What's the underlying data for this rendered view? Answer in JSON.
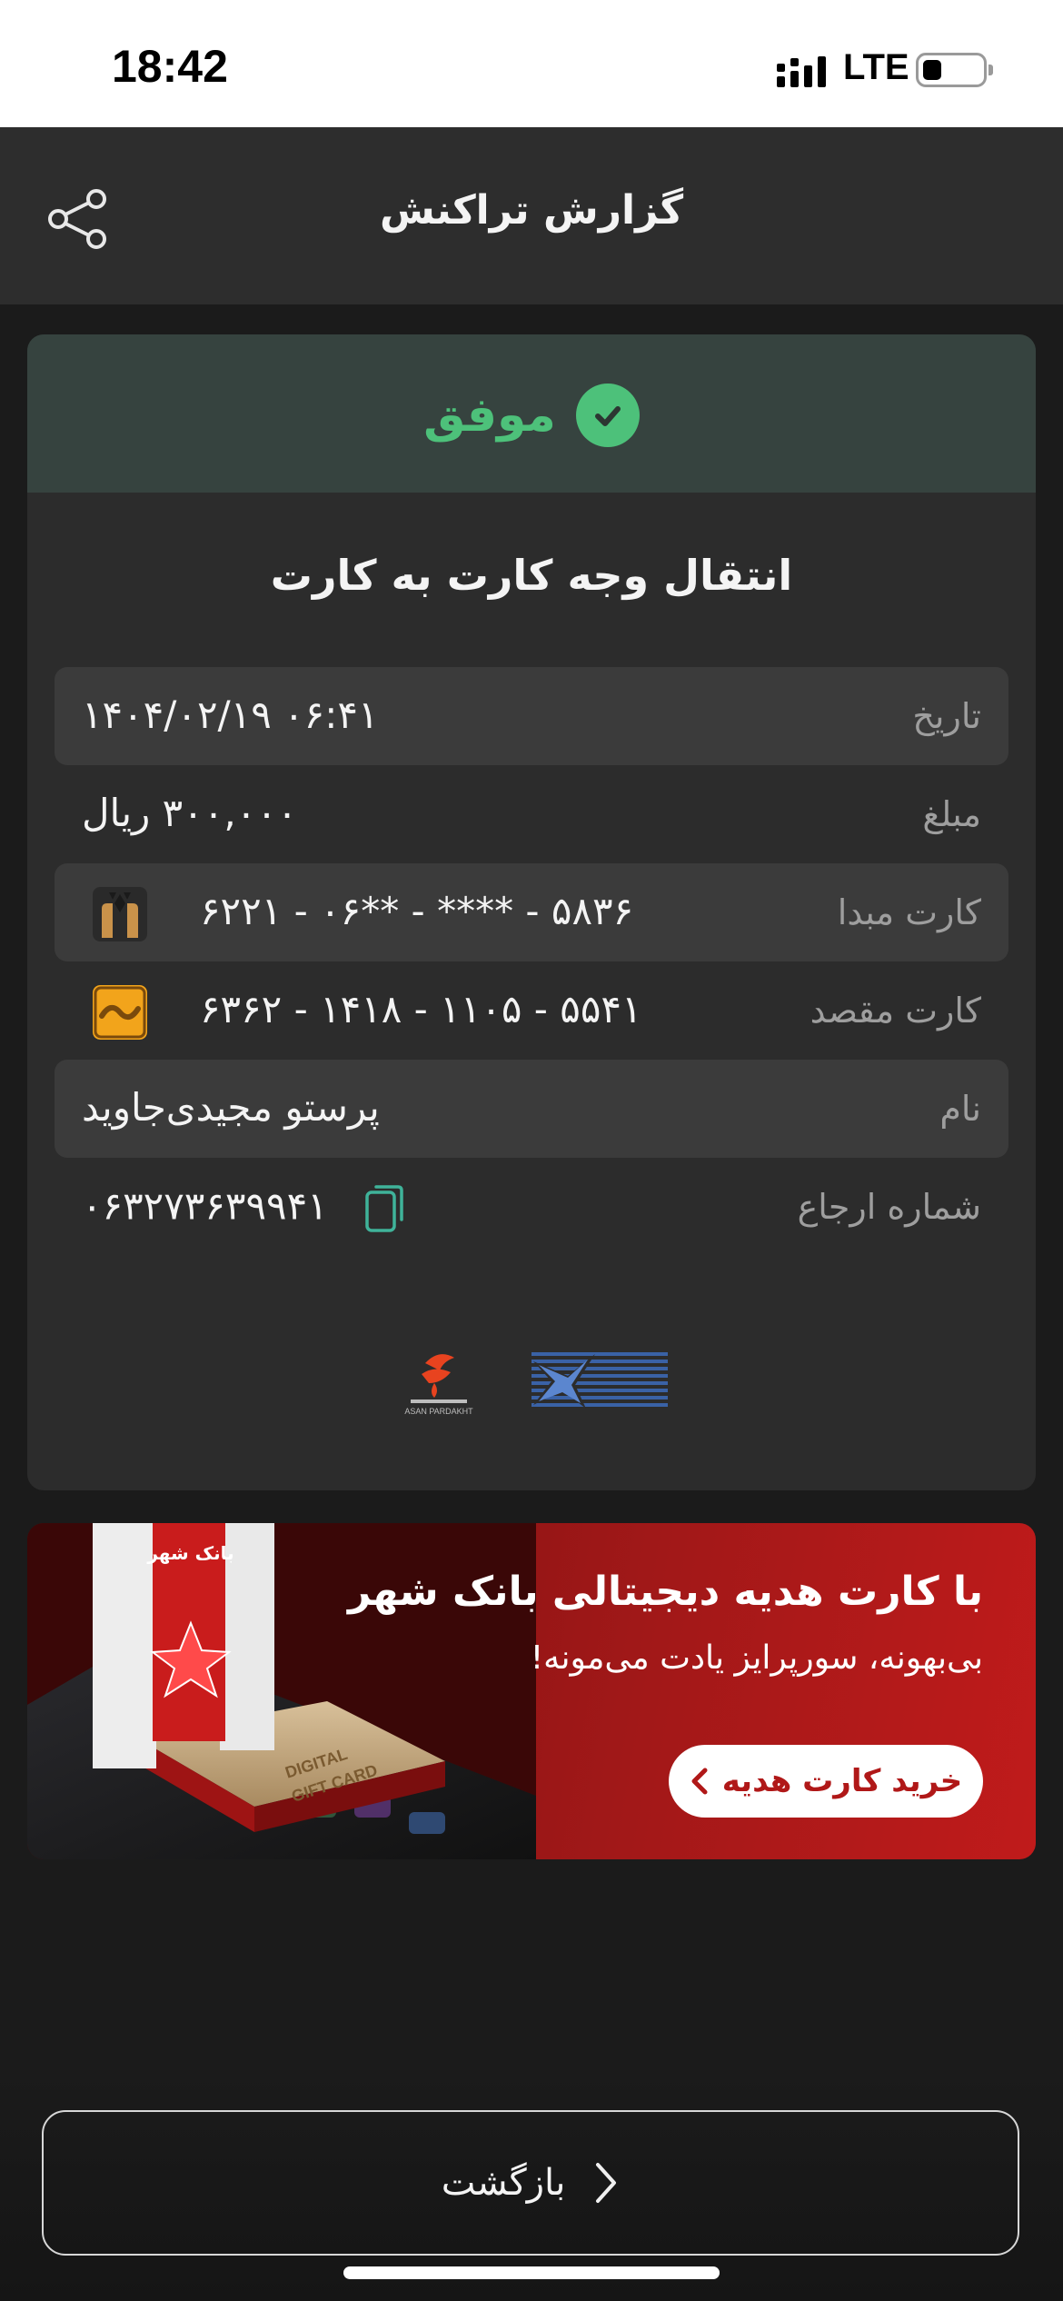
{
  "status_bar": {
    "time": "18:42",
    "network": "LTE"
  },
  "header": {
    "title": "گزارش تراکنش",
    "share_icon": "share-icon"
  },
  "receipt": {
    "status": "موفق",
    "status_color": "#4dc17a",
    "transaction_type": "انتقال وجه کارت به کارت",
    "rows": [
      {
        "label": "تاریخ",
        "value": "۱۴۰۴/۰۲/۱۹ ۰۶:۴۱"
      },
      {
        "label": "مبلغ",
        "value": "۳۰۰,۰۰۰ ریال"
      },
      {
        "label": "کارت مبدا",
        "value": "۶۲۲۱ - ۰۶** - **** - ۵۸۳۶"
      },
      {
        "label": "کارت مقصد",
        "value": "۶۳۶۲ - ۱۴۱۸ - ۱۱۰۵ - ۵۵۴۱"
      },
      {
        "label": "نام",
        "value": "پرستو مجیدی‌جاوید"
      },
      {
        "label": "شماره ارجاع",
        "value": "۰۶۳۲۷۳۶۳۹۹۴۱"
      }
    ]
  },
  "banner": {
    "headline": "با کارت هدیه دیجیتالی بانک شهر",
    "subline": "بی‌بهونه، سورپرایز یادت می‌مونه!",
    "cta_label": "خرید کارت هدیه",
    "package_line1": "DIGITAL",
    "package_line2": "GIFT CARD",
    "package_brand": "بانک شهر",
    "brand_color": "#c01b1b"
  },
  "footer": {
    "back_label": "بازگشت"
  },
  "logos": {
    "asan_pardakht": "ASAN PARDAKHT",
    "shaparak": "shaparak-logo"
  }
}
